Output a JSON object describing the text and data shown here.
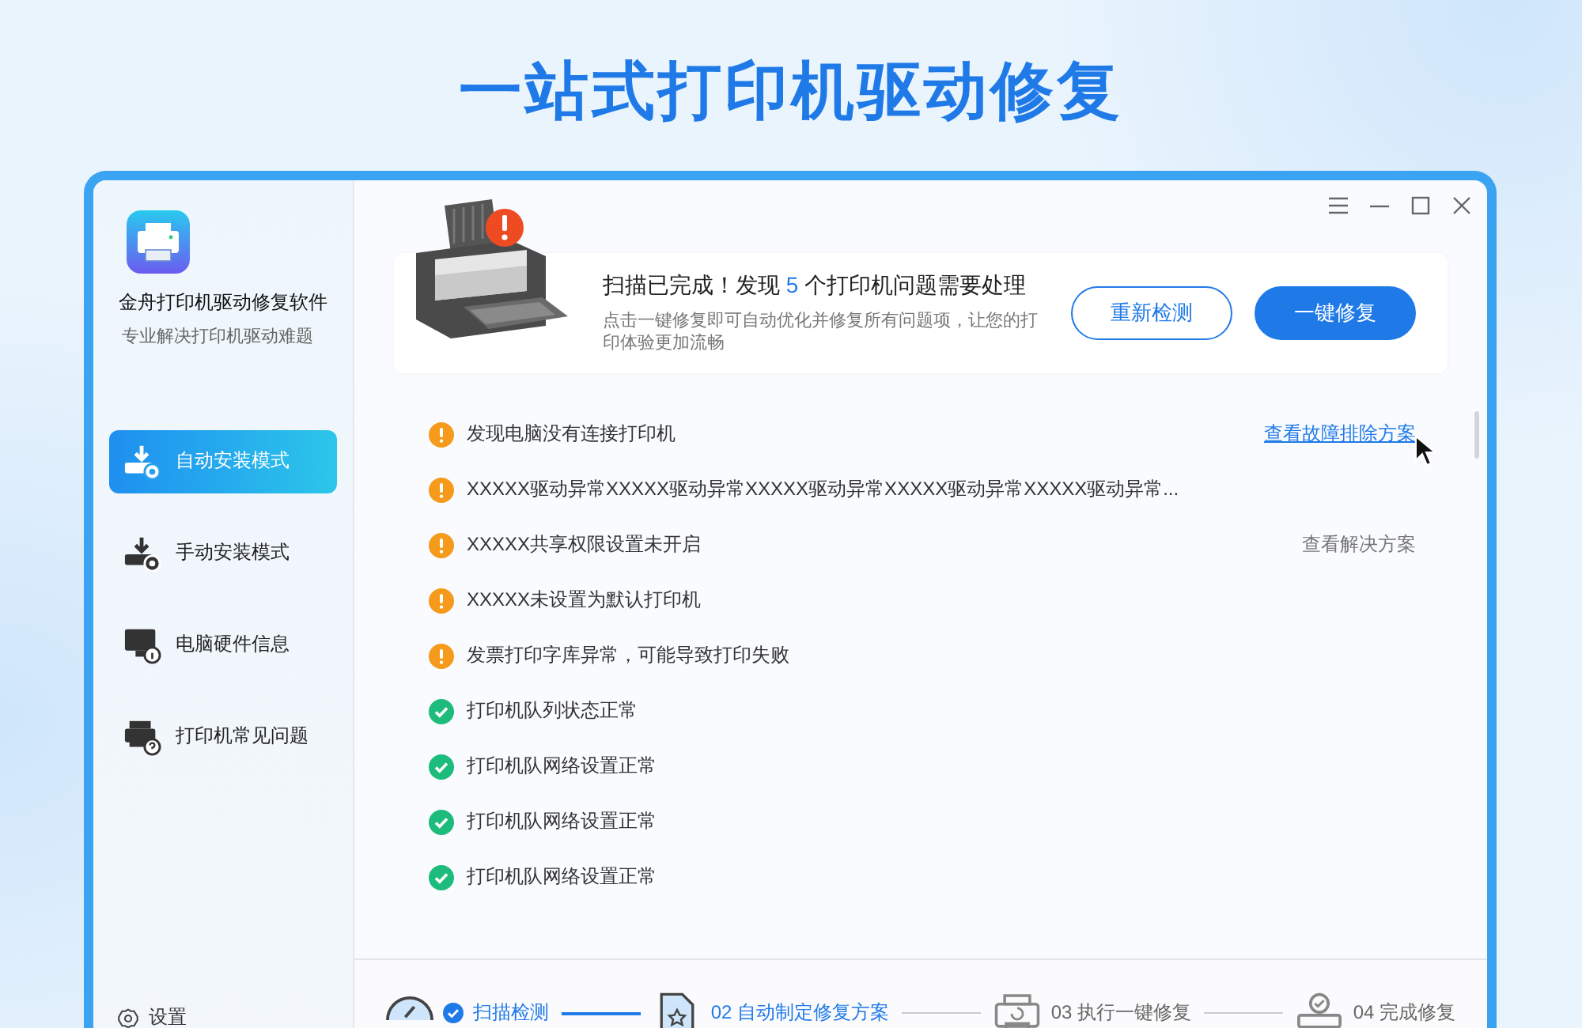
{
  "headline": "一站式打印机驱动修复",
  "app": {
    "name": "金舟打印机驱动修复软件",
    "subtitle": "专业解决打印机驱动难题"
  },
  "nav": [
    {
      "label": "自动安装模式",
      "selected": true
    },
    {
      "label": "手动安装模式",
      "selected": false
    },
    {
      "label": "电脑硬件信息",
      "selected": false
    },
    {
      "label": "打印机常见问题",
      "selected": false
    }
  ],
  "settings": "设置",
  "summary": {
    "title_before": "扫描已完成！发现 ",
    "count": "5",
    "title_after": " 个打印机问题需要处理",
    "description": "点击一键修复即可自动优化并修复所有问题项，让您的打印体验更加流畅",
    "rescan": "重新检测",
    "repair": "一键修复"
  },
  "results": [
    {
      "kind": "warning",
      "text": "发现电脑没有连接打印机",
      "action": {
        "kind": "link",
        "text": "查看故障排除方案"
      }
    },
    {
      "kind": "warning",
      "text": "XXXXX驱动异常XXXXX驱动异常XXXXX驱动异常XXXXX驱动异常XXXXX驱动异常..."
    },
    {
      "kind": "warning",
      "text": "XXXXX共享权限设置未开启",
      "action": {
        "kind": "plain",
        "text": "查看解决方案"
      }
    },
    {
      "kind": "warning",
      "text": "XXXXX未设置为默认打印机"
    },
    {
      "kind": "warning",
      "text": "发票打印字库异常，可能导致打印失败"
    },
    {
      "kind": "ok",
      "text": "打印机队列状态正常"
    },
    {
      "kind": "ok",
      "text": "打印机队网络设置正常"
    },
    {
      "kind": "ok",
      "text": "打印机队网络设置正常"
    },
    {
      "kind": "ok",
      "text": "打印机队网络设置正常"
    }
  ],
  "steps": [
    {
      "completed": true,
      "highlighted": true,
      "label": "扫描检测"
    },
    {
      "completed": false,
      "highlighted": true,
      "label": "02 自动制定修复方案"
    },
    {
      "completed": false,
      "highlighted": false,
      "label": "03 执行一键修复"
    },
    {
      "completed": false,
      "highlighted": false,
      "label": "04 完成修复"
    }
  ]
}
